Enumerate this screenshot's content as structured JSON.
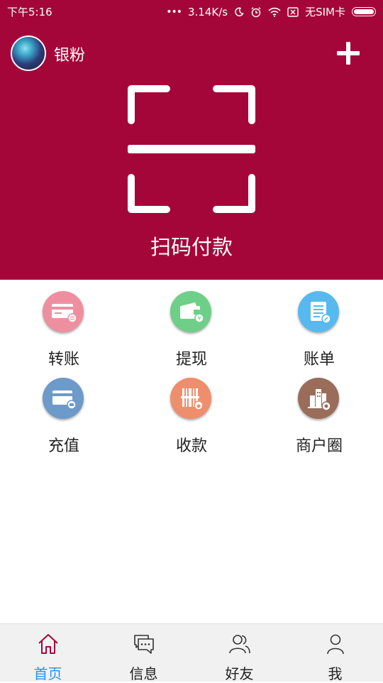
{
  "status_bar": {
    "time": "下午5:16",
    "dots": "•••",
    "speed": "3.14K/s",
    "sim": "无SIM卡"
  },
  "header": {
    "username": "银粉",
    "scan_label": "扫码付款",
    "background_color": "#a5063a"
  },
  "actions": [
    {
      "label": "转账",
      "icon": "bank-card-transfer-icon",
      "color": "#ee8f9f"
    },
    {
      "label": "提现",
      "icon": "wallet-yuan-icon",
      "color": "#6ecf88"
    },
    {
      "label": "账单",
      "icon": "bill-document-icon",
      "color": "#57b9ee"
    },
    {
      "label": "充值",
      "icon": "card-recharge-icon",
      "color": "#6c9ac9"
    },
    {
      "label": "收款",
      "icon": "barcode-money-icon",
      "color": "#ef8e6d"
    },
    {
      "label": "商户圈",
      "icon": "merchant-buildings-icon",
      "color": "#9a6d5b"
    }
  ],
  "tabs": [
    {
      "label": "首页",
      "icon": "home-icon",
      "active": true
    },
    {
      "label": "信息",
      "icon": "message-icon",
      "active": false
    },
    {
      "label": "好友",
      "icon": "friends-icon",
      "active": false
    },
    {
      "label": "我",
      "icon": "profile-icon",
      "active": false
    }
  ],
  "colors": {
    "tab_active": "#2196f3",
    "tab_active_icon": "#a5063a"
  }
}
